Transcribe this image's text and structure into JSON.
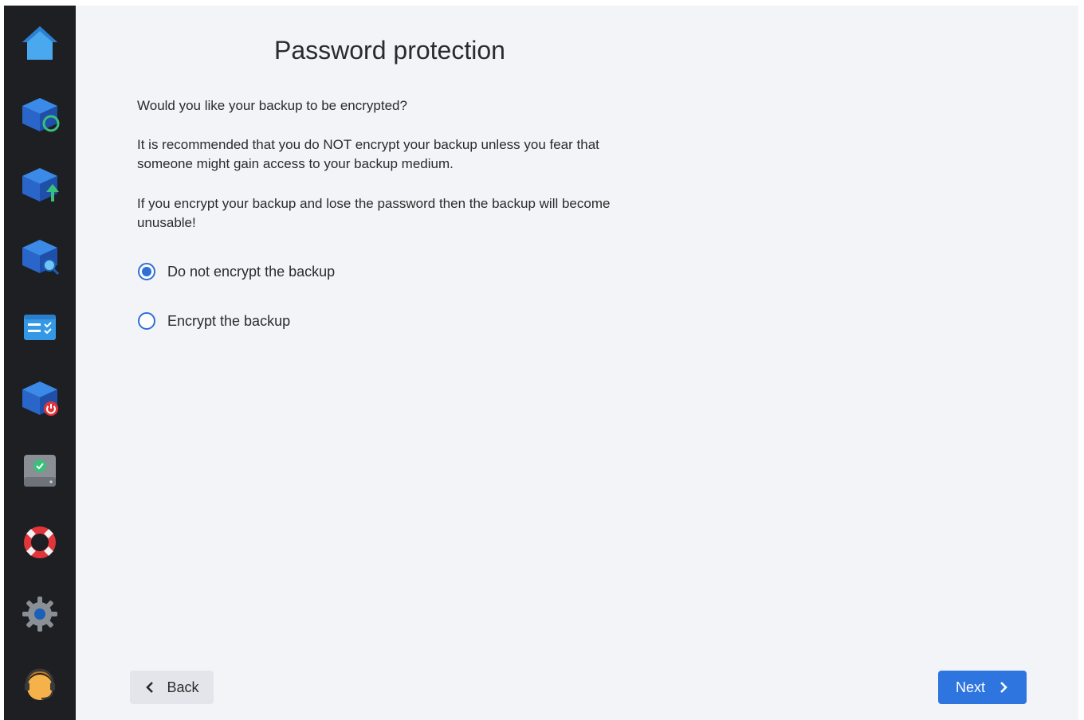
{
  "page": {
    "title": "Password protection",
    "question": "Would you like your backup to be encrypted?",
    "recommendation": "It is recommended that you do NOT encrypt your backup unless you fear that someone might gain access to your backup medium.",
    "warning": "If you encrypt your backup and lose the password then the backup will become unusable!"
  },
  "options": [
    {
      "label": "Do not encrypt the backup",
      "selected": true
    },
    {
      "label": "Encrypt the backup",
      "selected": false
    }
  ],
  "buttons": {
    "back_label": "Back",
    "next_label": "Next"
  },
  "sidebar": {
    "items": [
      {
        "icon": "home-icon"
      },
      {
        "icon": "backup-refresh-icon"
      },
      {
        "icon": "backup-upload-icon"
      },
      {
        "icon": "backup-search-icon"
      },
      {
        "icon": "task-list-icon"
      },
      {
        "icon": "backup-power-icon"
      },
      {
        "icon": "drive-check-icon"
      },
      {
        "icon": "lifebuoy-icon"
      },
      {
        "icon": "gear-icon"
      },
      {
        "icon": "support-agent-icon"
      }
    ]
  },
  "colors": {
    "accent": "#2f75e0",
    "sidebar": "#1d1f22",
    "background": "#f3f4f8"
  }
}
